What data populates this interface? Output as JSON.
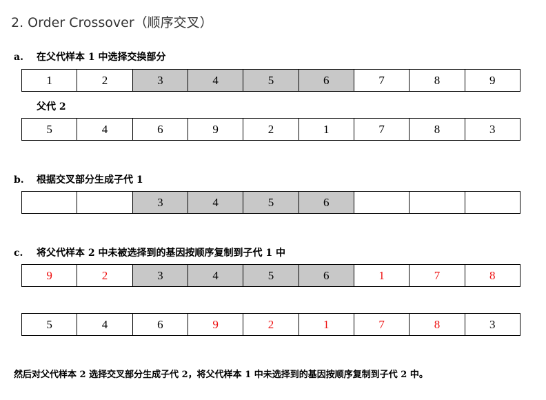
{
  "heading": "2. Order Crossover（顺序交叉）",
  "step_a": {
    "letter": "a.",
    "text": "在父代样本 1 中选择交换部分"
  },
  "parent2_label": "父代 2",
  "step_b": {
    "letter": "b.",
    "text": "根据交叉部分生成子代 1"
  },
  "step_c": {
    "letter": "c.",
    "text": "将父代样本 2 中未被选择到的基因按顺序复制到子代 1 中"
  },
  "footer": "然后对父代样本 2 选择交叉部分生成子代 2，将父代样本 1 中未选择到的基因按顺序复制到子代 2 中。",
  "colors": {
    "shade": "#c8c8c8",
    "highlight": "#ee1111"
  },
  "rows": {
    "parent1": [
      {
        "v": "1"
      },
      {
        "v": "2"
      },
      {
        "v": "3",
        "shade": true
      },
      {
        "v": "4",
        "shade": true
      },
      {
        "v": "5",
        "shade": true
      },
      {
        "v": "6",
        "shade": true
      },
      {
        "v": "7"
      },
      {
        "v": "8"
      },
      {
        "v": "9"
      }
    ],
    "parent2": [
      {
        "v": "5"
      },
      {
        "v": "4"
      },
      {
        "v": "6"
      },
      {
        "v": "9"
      },
      {
        "v": "2"
      },
      {
        "v": "1"
      },
      {
        "v": "7"
      },
      {
        "v": "8"
      },
      {
        "v": "3"
      }
    ],
    "child_partial": [
      {
        "v": ""
      },
      {
        "v": ""
      },
      {
        "v": "3",
        "shade": true
      },
      {
        "v": "4",
        "shade": true
      },
      {
        "v": "5",
        "shade": true
      },
      {
        "v": "6",
        "shade": true
      },
      {
        "v": ""
      },
      {
        "v": ""
      },
      {
        "v": ""
      }
    ],
    "child_full": [
      {
        "v": "9",
        "red": true
      },
      {
        "v": "2",
        "red": true
      },
      {
        "v": "3",
        "shade": true
      },
      {
        "v": "4",
        "shade": true
      },
      {
        "v": "5",
        "shade": true
      },
      {
        "v": "6",
        "shade": true
      },
      {
        "v": "1",
        "red": true
      },
      {
        "v": "7",
        "red": true
      },
      {
        "v": "8",
        "red": true
      }
    ],
    "parent2_marked": [
      {
        "v": "5"
      },
      {
        "v": "4"
      },
      {
        "v": "6"
      },
      {
        "v": "9",
        "red": true
      },
      {
        "v": "2",
        "red": true
      },
      {
        "v": "1",
        "red": true
      },
      {
        "v": "7",
        "red": true
      },
      {
        "v": "8",
        "red": true
      },
      {
        "v": "3"
      }
    ]
  }
}
